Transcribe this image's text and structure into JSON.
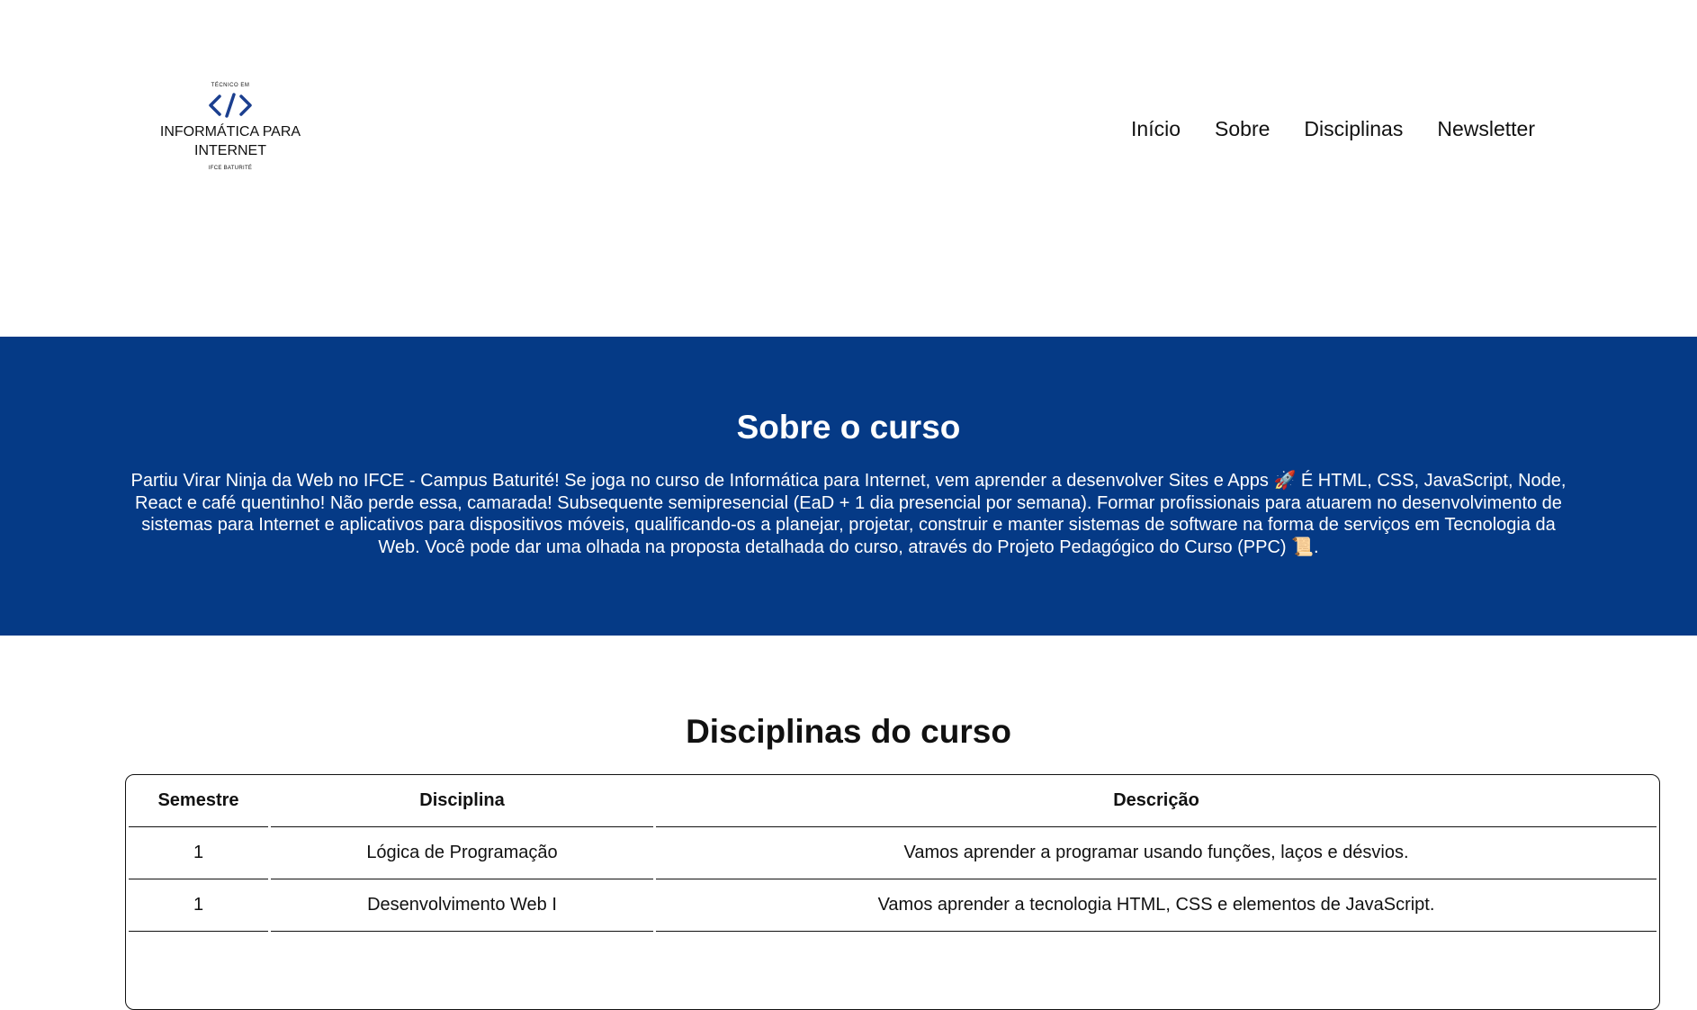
{
  "header": {
    "logo": {
      "top_text": "TÉCNICO EM",
      "icon": "code-icon",
      "title_line1": "INFORMÁTICA PARA",
      "title_line2": "INTERNET",
      "bottom_text": "IFCE BATURITÉ"
    },
    "nav": [
      {
        "label": "Início"
      },
      {
        "label": "Sobre"
      },
      {
        "label": "Disciplinas"
      },
      {
        "label": "Newsletter"
      }
    ]
  },
  "about": {
    "title": "Sobre o curso",
    "text": "Partiu Virar Ninja da Web no IFCE - Campus Baturité! Se joga no curso de Informática para Internet, vem aprender a desenvolver Sites e Apps 🚀 É HTML, CSS, JavaScript, Node, React e café quentinho! Não perde essa, camarada! Subsequente semipresencial (EaD + 1 dia presencial por semana). Formar profissionais para atuarem no desenvolvimento de sistemas para Internet e aplicativos para dispositivos móveis, qualificando-os a planejar, projetar, construir e manter sistemas de software na forma de serviços em Tecnologia da Web. Você pode dar uma olhada na proposta detalhada do curso, através do Projeto Pedagógico do Curso (PPC) 📜.",
    "background": "#053a86"
  },
  "disciplines": {
    "title": "Disciplinas do curso",
    "headers": [
      "Semestre",
      "Disciplina",
      "Descrição"
    ],
    "rows": [
      [
        "1",
        "Lógica de Programação",
        "Vamos aprender a programar usando funções, laços e désvios."
      ],
      [
        "1",
        "Desenvolvimento Web I",
        "Vamos aprender a tecnologia HTML, CSS e elementos de JavaScript."
      ]
    ]
  }
}
